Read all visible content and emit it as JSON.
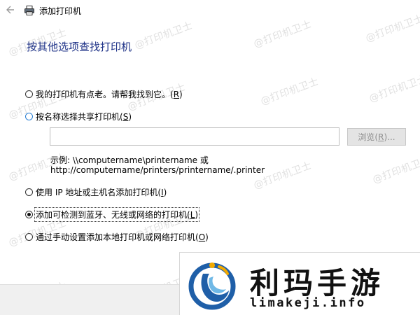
{
  "window": {
    "title": "添加打印机"
  },
  "heading": "按其他选项查找打印机",
  "options": [
    {
      "label": "我的打印机有点老。请帮我找到它。",
      "key": "R",
      "checked": false
    },
    {
      "label": "按名称选择共享打印机",
      "key": "S",
      "checked": false
    },
    {
      "label": "使用 IP 地址或主机名添加打印机",
      "key": "I",
      "checked": false
    },
    {
      "label": "添加可检测到蓝牙、无线或网络的打印机",
      "key": "L",
      "checked": true
    },
    {
      "label": "通过手动设置添加本地打印机或网络打印机",
      "key": "O",
      "checked": false
    }
  ],
  "share_input": {
    "value": ""
  },
  "browse_button": {
    "label": "浏览(",
    "key": "R",
    "suffix": ")..."
  },
  "example": {
    "line1": "示例: \\\\computername\\printername 或",
    "line2": "http://computername/printers/printername/.printer"
  },
  "watermark": {
    "text": "@打印机卫士"
  },
  "logo": {
    "name": "利玛手游",
    "url": "limakeji.info",
    "colors": {
      "primary": "#1f5fa8",
      "accent": "#f2a900"
    }
  },
  "colors": {
    "heading": "#1e3287",
    "radio_highlight": "#2a7fd4"
  }
}
